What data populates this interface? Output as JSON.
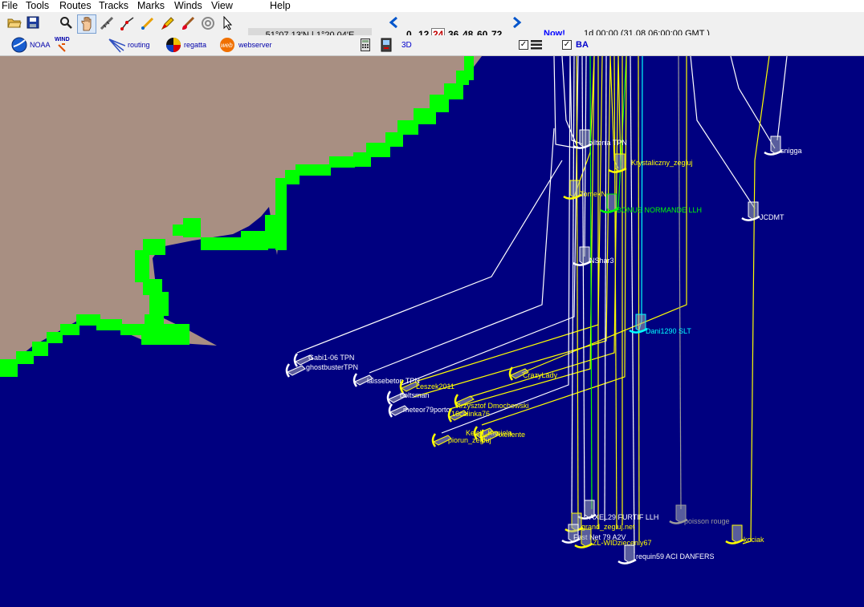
{
  "menu": {
    "file": "File",
    "tools": "Tools",
    "routes": "Routes",
    "tracks": "Tracks",
    "marks": "Marks",
    "winds": "Winds",
    "view": "View",
    "help": "Help"
  },
  "toolbar": {
    "coordinates": "51°07.13'N | 1°20.04'E",
    "hours": [
      "0",
      "12",
      "24",
      "36",
      "48",
      "60",
      "72"
    ],
    "selected_hour": "24",
    "now_label": "Now!",
    "time_info": "1d 00:00 (31.08 06:00:00 GMT )"
  },
  "plugins": {
    "noaa": "NOAA",
    "wind": "WIND",
    "routing": "routing",
    "regatta": "regatta",
    "webserver": "webserver",
    "three_d": "3D",
    "ba": "BA"
  },
  "colors": {
    "sea": "#000080",
    "land": "#a88f82",
    "coast": "#00ff00",
    "white_track": "#ffffff",
    "yellow_track": "#ffff00",
    "green_track": "#00ff00",
    "cyan": "#00ffff",
    "grey": "#9a9a9a"
  },
  "boats": [
    {
      "name": "bilterra TPN"
    },
    {
      "name": "Krystaliczny_zegluj"
    },
    {
      "name": "snigga"
    },
    {
      "name": "TomekN"
    },
    {
      "name": "BONUS NORMANDE LLH"
    },
    {
      "name": "JCDMT"
    },
    {
      "name": "NShar3"
    },
    {
      "name": "Dani1290 SLT"
    },
    {
      "name": "Gabi1-06 TPN"
    },
    {
      "name": "ghostbusterTPN"
    },
    {
      "name": "laissebeton TPN"
    },
    {
      "name": "CrazyLady"
    },
    {
      "name": "Leszek2011"
    },
    {
      "name": "boltsman"
    },
    {
      "name": "meteor79porto"
    },
    {
      "name": "Krzysztof Dmochowski"
    },
    {
      "name": "16calinka76"
    },
    {
      "name": "Kelch_Kaniela"
    },
    {
      "name": "Axellente"
    },
    {
      "name": "piorun_zegluj"
    },
    {
      "name": "AXEL29 FURTIF LLH"
    },
    {
      "name": "poisson rouge"
    },
    {
      "name": "grand_zegluj.net"
    },
    {
      "name": "Fast Net 79 A2V"
    },
    {
      "name": "ZL-WIDziecenly67"
    },
    {
      "name": "kociak"
    },
    {
      "name": "requin59 ACI DANFERS"
    }
  ]
}
